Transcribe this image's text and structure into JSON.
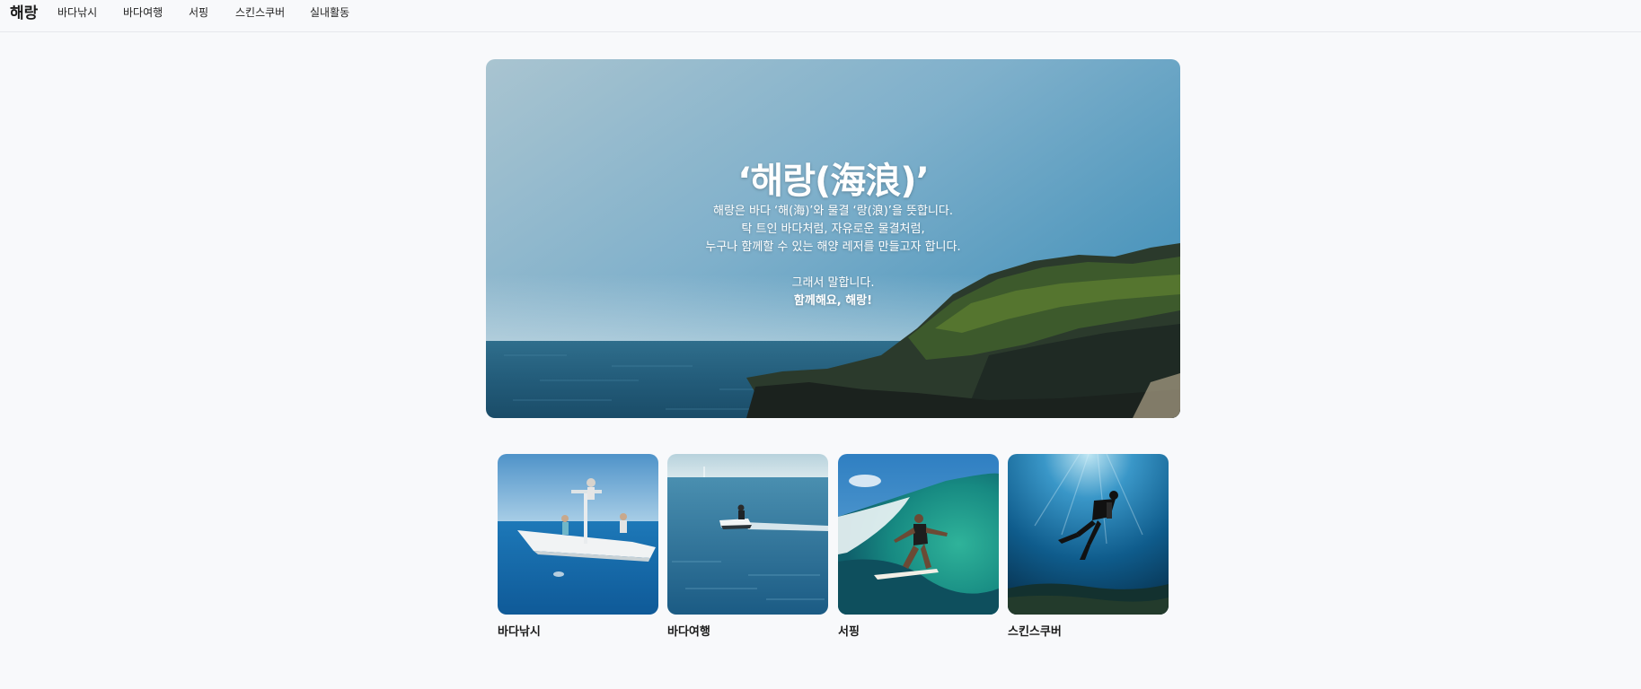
{
  "brand": "해랑",
  "nav": [
    {
      "label": "바다낚시"
    },
    {
      "label": "바다여행"
    },
    {
      "label": "서핑"
    },
    {
      "label": "스킨스쿠버"
    },
    {
      "label": "실내활동"
    }
  ],
  "hero": {
    "title": "‘해랑(海浪)’",
    "lines": [
      "해랑은 바다 ‘해(海)’와 물결 ‘랑(浪)’을 뜻합니다.",
      "탁 트인 바다처럼, 자유로운 물결처럼,",
      "누구나 함께할 수 있는 해양 레저를 만들고자 합니다.",
      "그래서 말합니다.",
      "함께해요, 해랑!"
    ]
  },
  "cards": [
    {
      "label": "바다낚시"
    },
    {
      "label": "바다여행"
    },
    {
      "label": "서핑"
    },
    {
      "label": "스킨스쿠버"
    }
  ],
  "colors": {
    "background": "#f8f9fb",
    "text": "#1b1b1b",
    "ocean": "#1f5f86",
    "sky": "#8fb5cc"
  }
}
